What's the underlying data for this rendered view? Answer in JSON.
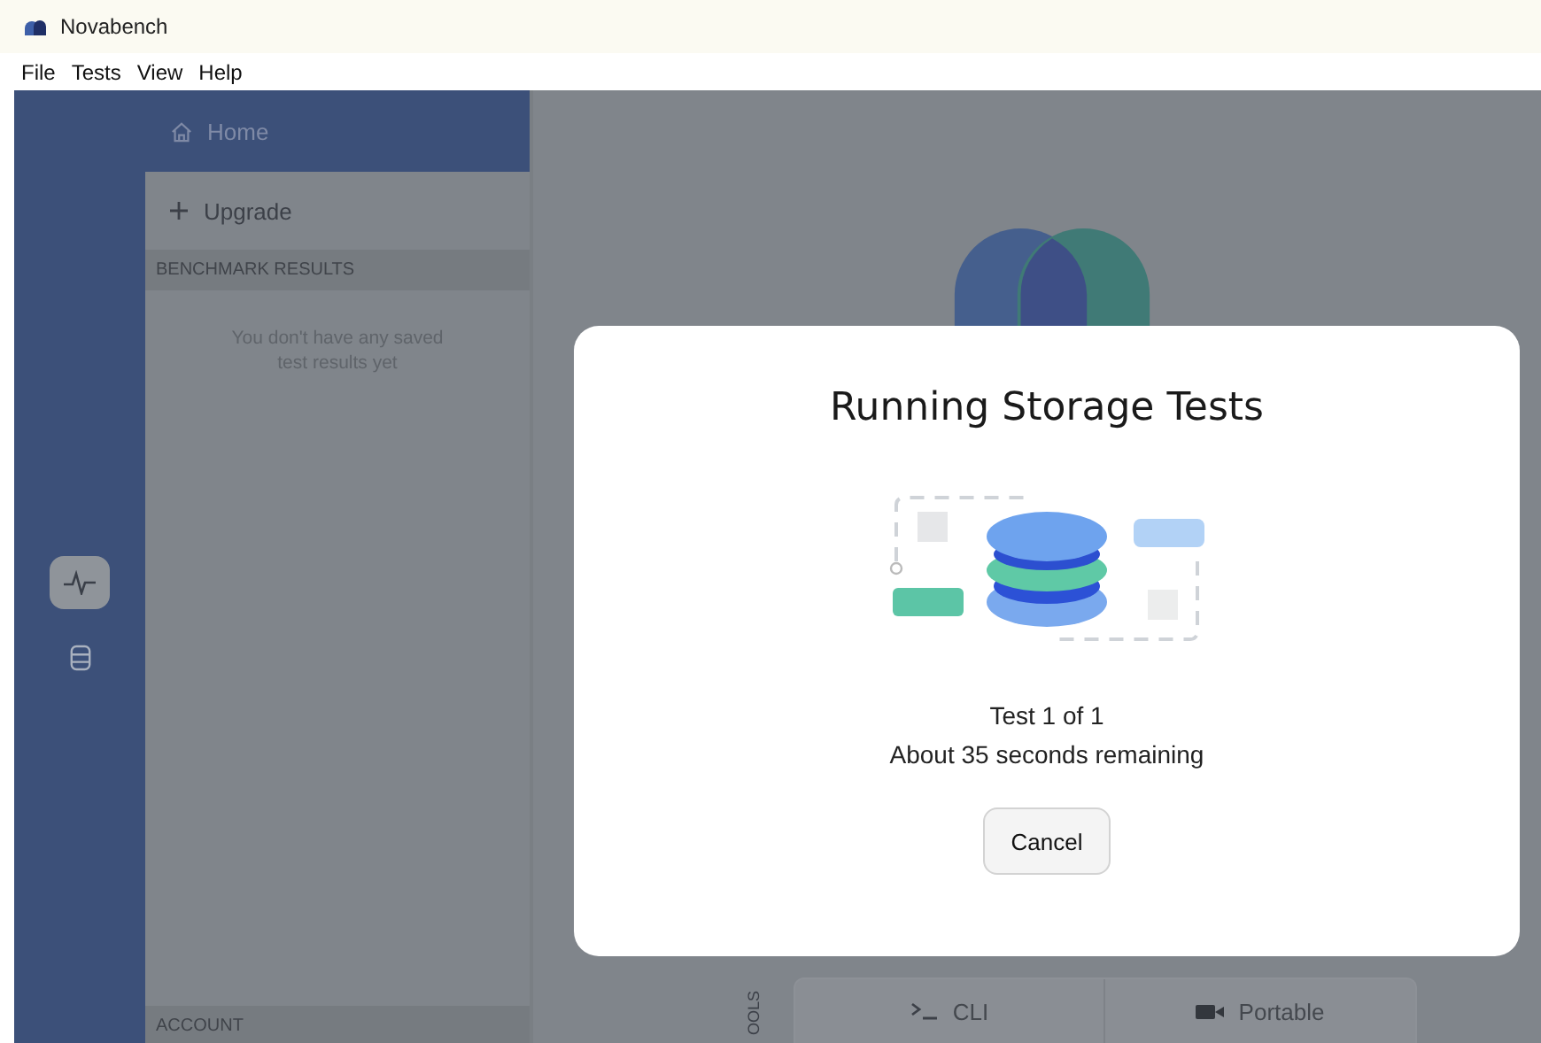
{
  "window": {
    "title": "Novabench"
  },
  "menu": [
    "File",
    "Tests",
    "View",
    "Help"
  ],
  "rail": [
    {
      "kind": "pulse",
      "selected": true
    },
    {
      "kind": "database",
      "selected": false
    }
  ],
  "sidebar": {
    "home": "Home",
    "upgrade": "Upgrade",
    "results_heading": "BENCHMARK RESULTS",
    "empty_message": "You don't have any saved test results yet",
    "account_heading": "ACCOUNT"
  },
  "tools": {
    "label": "OOLS",
    "buttons": [
      {
        "kind": "cli",
        "label": "CLI"
      },
      {
        "kind": "portable",
        "label": "Portable"
      }
    ]
  },
  "dialog": {
    "title": "Running Storage Tests",
    "progress": "Test 1 of 1",
    "remaining": "About 35 seconds remaining",
    "cancel": "Cancel"
  }
}
